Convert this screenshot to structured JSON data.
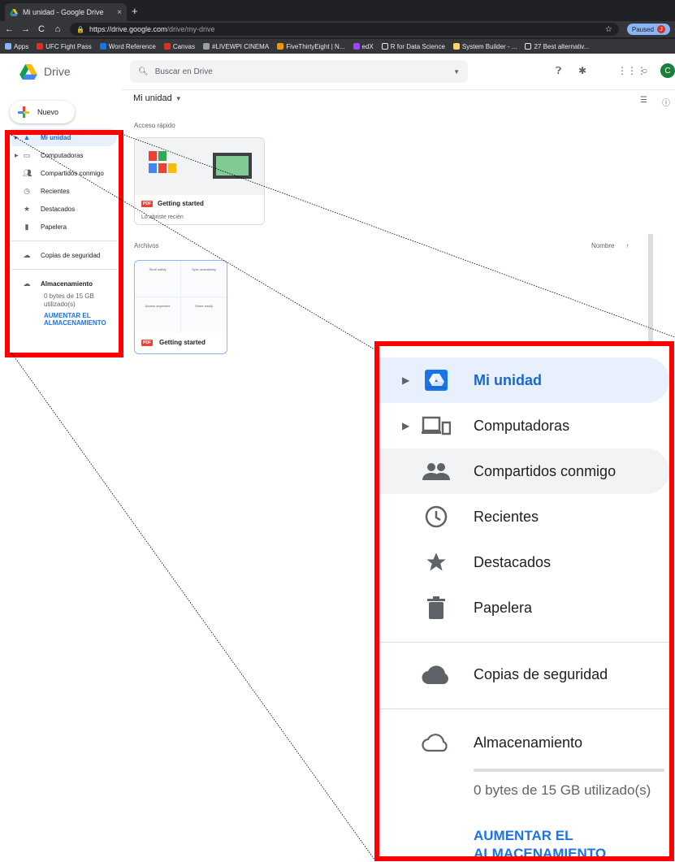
{
  "browser": {
    "tab_title": "Mi unidad - Google Drive",
    "tab_close": "×",
    "new_tab": "+",
    "url_host": "https://drive.google.com",
    "url_path": "/drive/my-drive",
    "paused_label": "Paused",
    "profile_initial": "J",
    "bookmarks": [
      "Apps",
      "UFC Fight Pass",
      "Word Reference",
      "Canvas",
      "#LIVEWPI CINEMA",
      "FiveThirtyEight | N...",
      "edX",
      "R for Data Science",
      "System Builder - ...",
      "27 Best alternativ..."
    ]
  },
  "drive": {
    "logo_text": "Drive",
    "search_placeholder": "Buscar en Drive",
    "new_button": "Nuevo",
    "avatar_initial": "C",
    "breadcrumb": "Mi unidad",
    "quick_access_heading": "Acceso rápido",
    "quick_card": {
      "name": "Getting started",
      "subtitle": "Lo abriste recién"
    },
    "files_heading": "Archivos",
    "sort_label": "Nombre",
    "file_card": {
      "name": "Getting started",
      "cells": [
        "Store safely",
        "Sync seamlessly",
        "Access anywhere",
        "Share easily"
      ]
    },
    "pdf_badge": "PDF"
  },
  "sidebar": {
    "items": [
      {
        "label": "Mi unidad"
      },
      {
        "label": "Computadoras"
      },
      {
        "label": "Compartidos conmigo"
      },
      {
        "label": "Recientes"
      },
      {
        "label": "Destacados"
      },
      {
        "label": "Papelera"
      }
    ],
    "backup": "Copias de seguridad",
    "storage": "Almacenamiento",
    "storage_used": "0 bytes de 15 GB utilizado(s)",
    "storage_fraction": 0,
    "upgrade": "AUMENTAR EL ALMACENAMIENTO"
  },
  "colors": {
    "highlight": "#ff0000",
    "selected_bg": "#e8f0fe",
    "accent": "#1a73e8"
  }
}
